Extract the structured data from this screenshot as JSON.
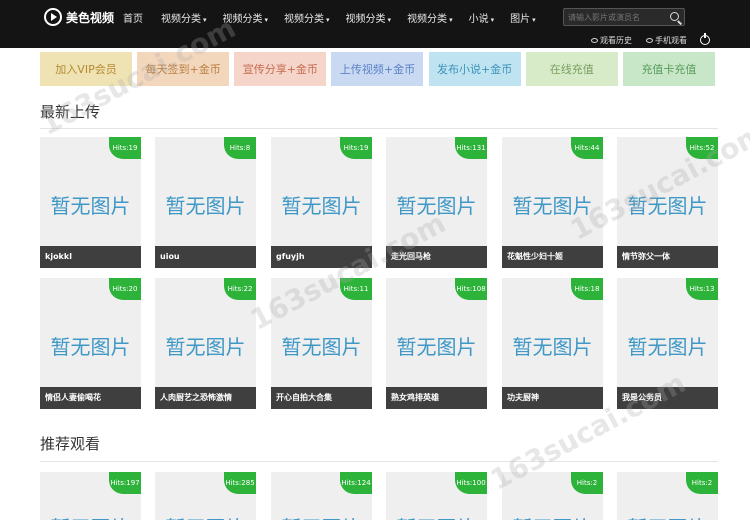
{
  "header": {
    "logo_text": "美色视频",
    "nav": [
      {
        "label": "首页",
        "caret": ""
      },
      {
        "label": "视频分类",
        "caret": "▾"
      },
      {
        "label": "视频分类",
        "caret": "▾"
      },
      {
        "label": "视频分类",
        "caret": "▾"
      },
      {
        "label": "视频分类",
        "caret": "▾"
      },
      {
        "label": "视频分类",
        "caret": "▾"
      },
      {
        "label": "小说",
        "caret": "▾"
      },
      {
        "label": "图片",
        "caret": "▾"
      }
    ],
    "search_placeholder": "请输入影片或演员名",
    "history_label": "观看历史",
    "mobile_label": "手机观看"
  },
  "actions": [
    {
      "label": "加入VIP会员",
      "bg": "#efe3b4",
      "color": "#b48a33"
    },
    {
      "label": "每天签到+金币",
      "bg": "#f3d7bc",
      "color": "#b98046"
    },
    {
      "label": "宣传分享+金币",
      "bg": "#f5d5ca",
      "color": "#c46b4e"
    },
    {
      "label": "上传视频+金币",
      "bg": "#c9d9f2",
      "color": "#5b82c7"
    },
    {
      "label": "发布小说+金币",
      "bg": "#bfe3f0",
      "color": "#3d93ba"
    },
    {
      "label": "在线充值",
      "bg": "#d7ebc8",
      "color": "#7a9e60"
    },
    {
      "label": "充值卡充值",
      "bg": "#c7e7c8",
      "color": "#5a9c5d"
    }
  ],
  "sections": {
    "latest_title": "最新上传",
    "recommend_title": "推荐观看"
  },
  "no_image_text": "暂无图片",
  "latest": [
    {
      "hits": "Hits:19",
      "title": "kjokkl"
    },
    {
      "hits": "Hits:8",
      "title": "uiou"
    },
    {
      "hits": "Hits:19",
      "title": "gfuyjh"
    },
    {
      "hits": "Hits:131",
      "title": "走光回马枪"
    },
    {
      "hits": "Hits:44",
      "title": "花魁性少妇十姬"
    },
    {
      "hits": "Hits:52",
      "title": "情节弥父一体"
    },
    {
      "hits": "Hits:20",
      "title": "情侣人妻偷喝花"
    },
    {
      "hits": "Hits:22",
      "title": "人肉厨艺之恐怖激情"
    },
    {
      "hits": "Hits:11",
      "title": "开心自拍大合集"
    },
    {
      "hits": "Hits:108",
      "title": "熟女鸡排英雄"
    },
    {
      "hits": "Hits:18",
      "title": "功夫厨神"
    },
    {
      "hits": "Hits:13",
      "title": "我是公务员"
    }
  ],
  "recommend": [
    {
      "hits": "Hits:197"
    },
    {
      "hits": "Hits:285"
    },
    {
      "hits": "Hits:124"
    },
    {
      "hits": "Hits:100"
    },
    {
      "hits": "Hits:2"
    },
    {
      "hits": "Hits:2"
    }
  ],
  "watermark": "163sucai.com"
}
